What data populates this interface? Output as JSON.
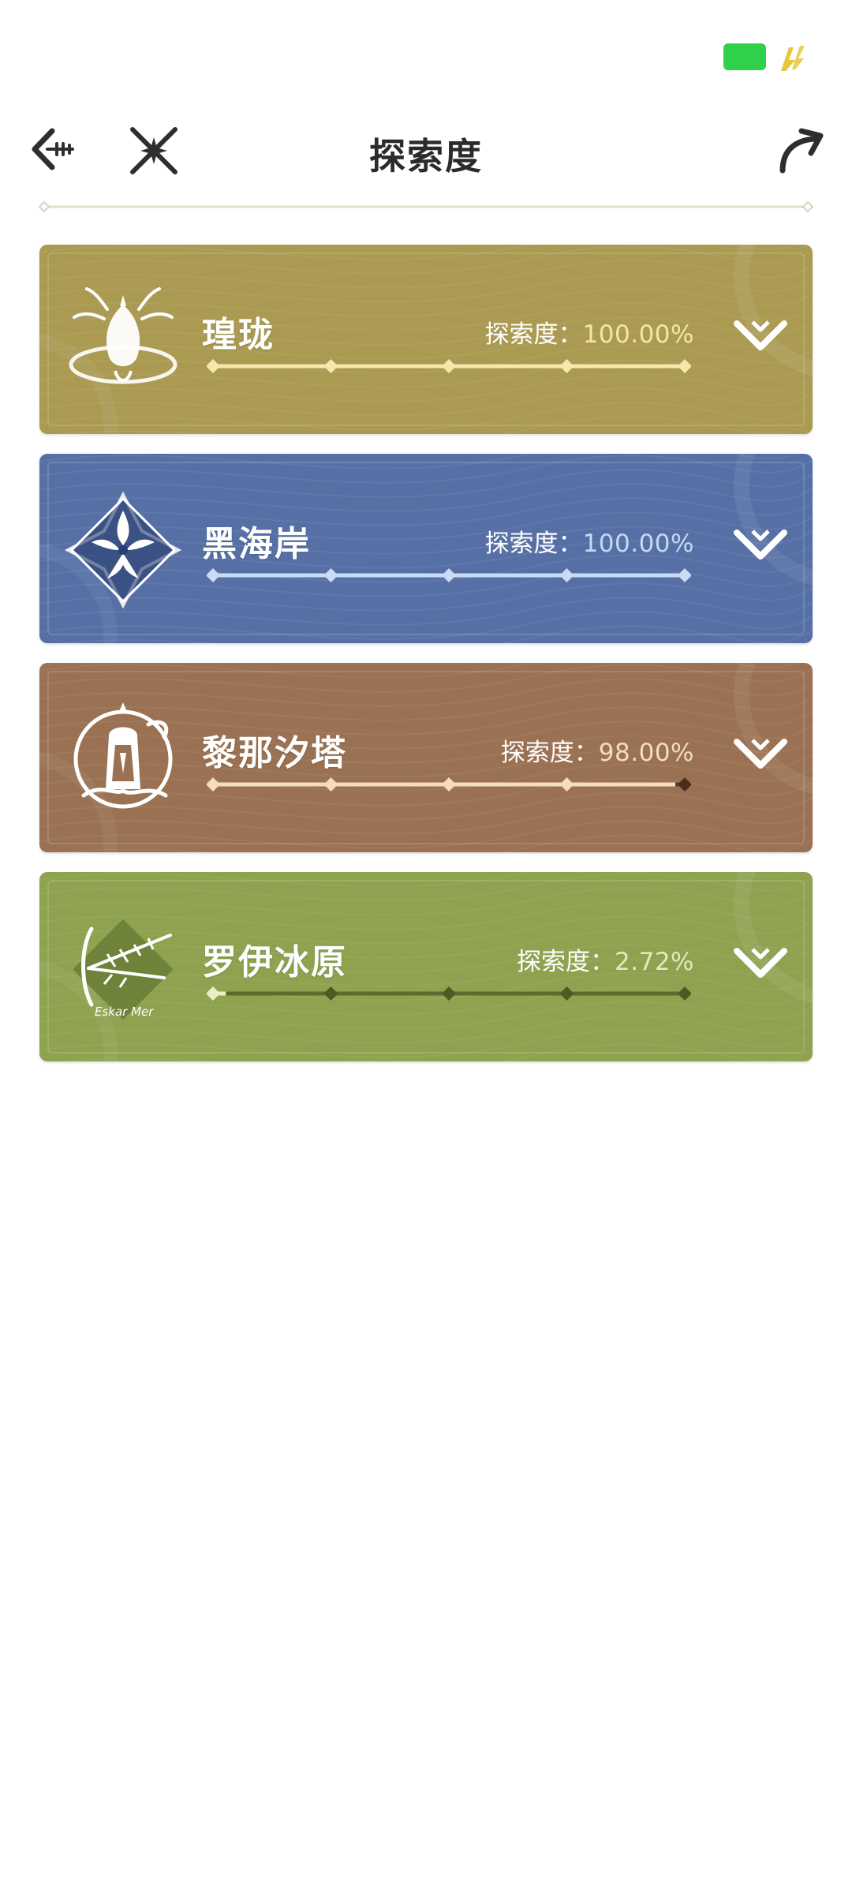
{
  "header": {
    "title": "探索度",
    "icons": {
      "back": "back-arrow-icon",
      "close": "cross-star-icon",
      "share": "share-arrow-icon"
    }
  },
  "status_bar": {
    "battery_color": "#2fd04a",
    "charge_color": "#e7c63a"
  },
  "regions": [
    {
      "name": "瑝珑",
      "progress_label": "探索度：",
      "progress_value": "100.00%",
      "progress": 1.0,
      "emblem": "dragon-emblem-icon",
      "colors": {
        "bg": "#aa9a52",
        "value": "#f5e6a8",
        "track": "#f6e8aa",
        "track_empty": "#6e6228"
      }
    },
    {
      "name": "黑海岸",
      "progress_label": "探索度：",
      "progress_value": "100.00%",
      "progress": 1.0,
      "emblem": "flower-star-emblem-icon",
      "colors": {
        "bg": "#5670a6",
        "value": "#c7d8f3",
        "track": "#c9dbf7",
        "track_empty": "#2c3f6a"
      }
    },
    {
      "name": "黎那汐塔",
      "progress_label": "探索度：",
      "progress_value": "98.00%",
      "progress": 0.98,
      "emblem": "lantern-tower-emblem-icon",
      "colors": {
        "bg": "#9a7152",
        "value": "#f3dcc0",
        "track": "#f4dcbc",
        "track_empty": "#4a2c1c"
      }
    },
    {
      "name": "罗伊冰原",
      "progress_label": "探索度：",
      "progress_value": "2.72%",
      "progress": 0.0272,
      "emblem": "ice-crest-emblem-icon",
      "emblem_text": "Eskar Mer",
      "colors": {
        "bg": "#8ea24f",
        "value": "#e2eabe",
        "track": "#e9f0c8",
        "track_empty": "#4d5a22"
      }
    }
  ]
}
